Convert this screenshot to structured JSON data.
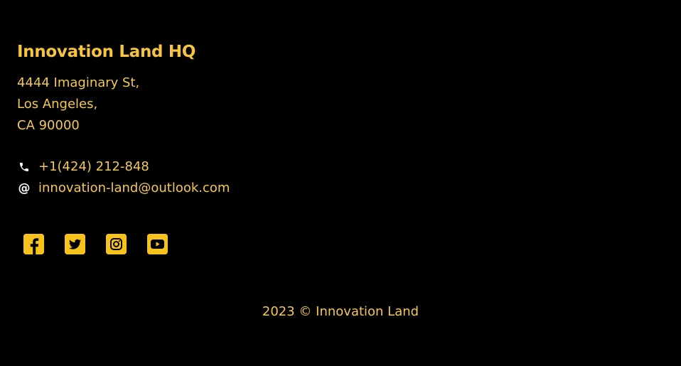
{
  "footer": {
    "title": "Innovation Land HQ",
    "address": {
      "line1": "4444 Imaginary St,",
      "line2": "Los Angeles,",
      "line3": "CA 90000"
    },
    "contact": {
      "phone": "+1(424) 212-848",
      "email": "innovation-land@outlook.com",
      "phone_icon": "phone-icon",
      "email_icon": "at-sign-icon"
    },
    "social": [
      {
        "name": "facebook-icon"
      },
      {
        "name": "twitter-icon"
      },
      {
        "name": "instagram-icon"
      },
      {
        "name": "youtube-icon"
      }
    ],
    "copyright": "2023 © Innovation Land"
  },
  "colors": {
    "background": "#000000",
    "accent": "#f6c21c",
    "text": "#f3c85a",
    "icon": "#ffffff"
  }
}
